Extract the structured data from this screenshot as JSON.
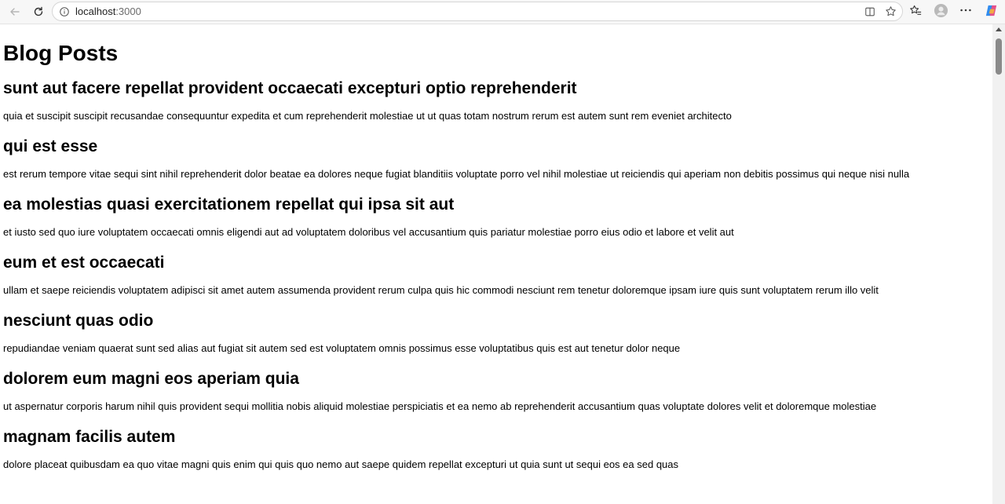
{
  "browser": {
    "url_host": "localhost",
    "url_port": ":3000",
    "icons": {
      "back": "back-arrow-icon",
      "reload": "reload-icon",
      "site_info": "info-icon",
      "split": "split-screen-icon",
      "favorite": "star-icon",
      "favorites": "favorites-icon",
      "profile": "profile-icon",
      "menu": "more-icon",
      "copilot": "copilot-icon"
    }
  },
  "page": {
    "title": "Blog Posts",
    "posts": [
      {
        "title": "sunt aut facere repellat provident occaecati excepturi optio reprehenderit",
        "body": "quia et suscipit suscipit recusandae consequuntur expedita et cum reprehenderit molestiae ut ut quas totam nostrum rerum est autem sunt rem eveniet architecto"
      },
      {
        "title": "qui est esse",
        "body": "est rerum tempore vitae sequi sint nihil reprehenderit dolor beatae ea dolores neque fugiat blanditiis voluptate porro vel nihil molestiae ut reiciendis qui aperiam non debitis possimus qui neque nisi nulla"
      },
      {
        "title": "ea molestias quasi exercitationem repellat qui ipsa sit aut",
        "body": "et iusto sed quo iure voluptatem occaecati omnis eligendi aut ad voluptatem doloribus vel accusantium quis pariatur molestiae porro eius odio et labore et velit aut"
      },
      {
        "title": "eum et est occaecati",
        "body": "ullam et saepe reiciendis voluptatem adipisci sit amet autem assumenda provident rerum culpa quis hic commodi nesciunt rem tenetur doloremque ipsam iure quis sunt voluptatem rerum illo velit"
      },
      {
        "title": "nesciunt quas odio",
        "body": "repudiandae veniam quaerat sunt sed alias aut fugiat sit autem sed est voluptatem omnis possimus esse voluptatibus quis est aut tenetur dolor neque"
      },
      {
        "title": "dolorem eum magni eos aperiam quia",
        "body": "ut aspernatur corporis harum nihil quis provident sequi mollitia nobis aliquid molestiae perspiciatis et ea nemo ab reprehenderit accusantium quas voluptate dolores velit et doloremque molestiae"
      },
      {
        "title": "magnam facilis autem",
        "body": "dolore placeat quibusdam ea quo vitae magni quis enim qui quis quo nemo aut saepe quidem repellat excepturi ut quia sunt ut sequi eos ea sed quas"
      }
    ]
  }
}
